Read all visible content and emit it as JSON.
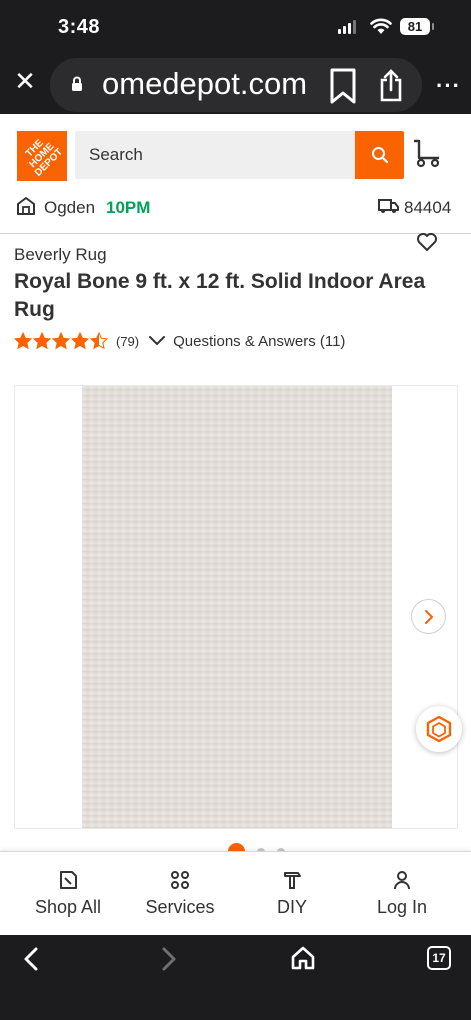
{
  "status_bar": {
    "time": "3:48",
    "battery": "81"
  },
  "browser": {
    "url": "omedepot.com",
    "tab_count": "17"
  },
  "header": {
    "logo_text": "THE\nHOME\nDEPOT",
    "search_placeholder": "Search",
    "store_name": "Ogden",
    "store_hours": "10PM",
    "zip": "84404"
  },
  "product": {
    "brand": "Beverly Rug",
    "title": "Royal Bone 9 ft. x 12 ft. Solid Indoor Area Rug",
    "rating": 4.5,
    "review_count": "(79)",
    "qa_label": "Questions & Answers (11)",
    "gallery_total_dots": 3,
    "gallery_active_index": 0
  },
  "bottom_nav": {
    "items": [
      {
        "label": "Shop All",
        "icon": "shop-all-icon"
      },
      {
        "label": "Services",
        "icon": "services-icon"
      },
      {
        "label": "DIY",
        "icon": "diy-hammer-icon"
      },
      {
        "label": "Log In",
        "icon": "person-icon"
      }
    ]
  },
  "colors": {
    "brand_orange": "#f96302",
    "hours_green": "#00a359"
  }
}
